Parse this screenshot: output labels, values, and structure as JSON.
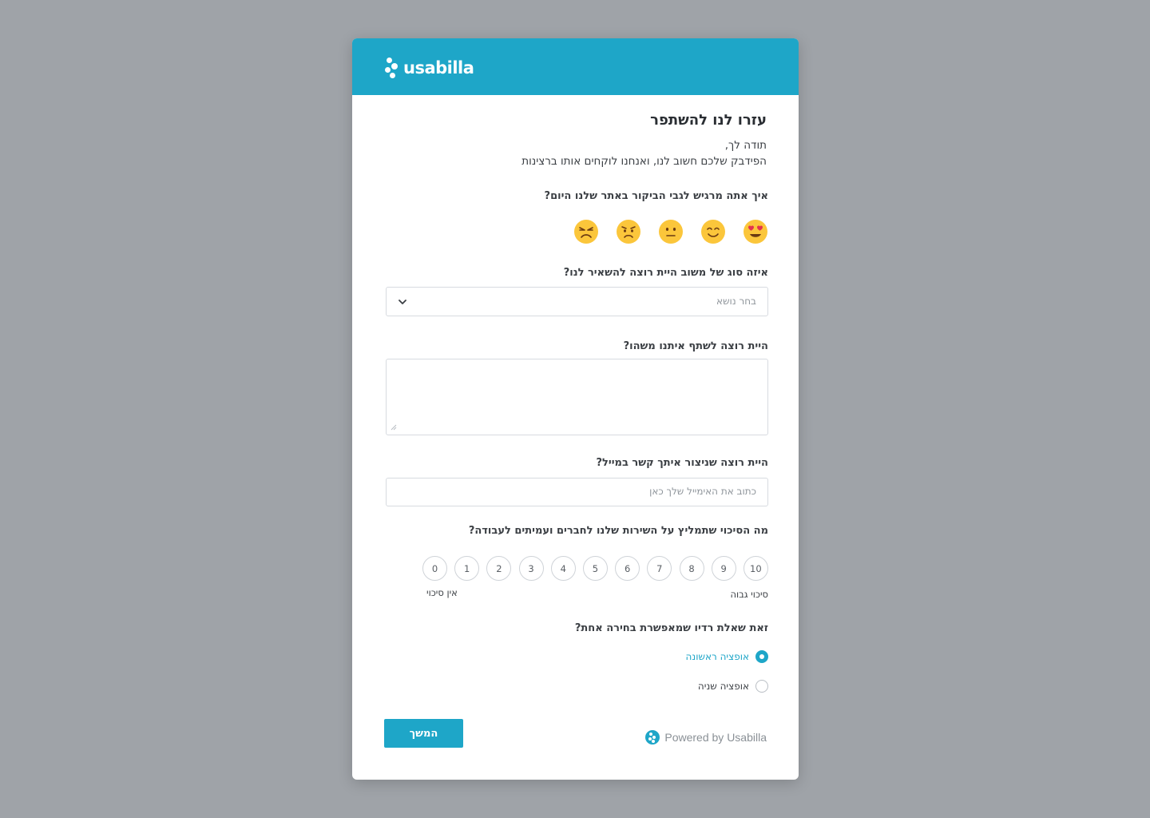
{
  "brand": {
    "name": "usabilla",
    "accent": "#1ea6c8"
  },
  "form": {
    "title": "עזרו לנו להשתפר",
    "intro_line1": "תודה לך,",
    "intro_line2": "הפידבק שלכם חשוב לנו, ואנחנו לוקחים אותו ברצינות",
    "mood_question": "איך אתה מרגיש לגבי הביקור באתר שלנו היום?",
    "moods": [
      "love-eyes-emoji",
      "smile-emoji",
      "neutral-emoji",
      "worried-emoji",
      "angry-emoji"
    ],
    "feedback_type_question": "איזה סוג של משוב היית רוצה להשאיר לנו?",
    "feedback_type_placeholder": "בחר נושא",
    "share_question": "היית רוצה לשתף איתנו משהו?",
    "share_value": "",
    "email_question": "היית רוצה שניצור איתך קשר במייל?",
    "email_placeholder": "כתוב את האימייל שלך כאן",
    "nps_question": "מה הסיכוי שתמליץ על השירות שלנו לחברים ועמיתים לעבודה?",
    "nps_options": [
      "0",
      "1",
      "2",
      "3",
      "4",
      "5",
      "6",
      "7",
      "8",
      "9",
      "10"
    ],
    "nps_low_label": "אין סיכוי",
    "nps_high_label": "סיכוי גבוה",
    "radio_question": "זאת שאלת רדיו שמאפשרת בחירה אחת?",
    "radio_options": [
      {
        "label": "אופציה ראשונה",
        "selected": true
      },
      {
        "label": "אופציה שניה",
        "selected": false
      }
    ],
    "next_label": "המשך",
    "powered_by": "Powered by Usabilla"
  }
}
